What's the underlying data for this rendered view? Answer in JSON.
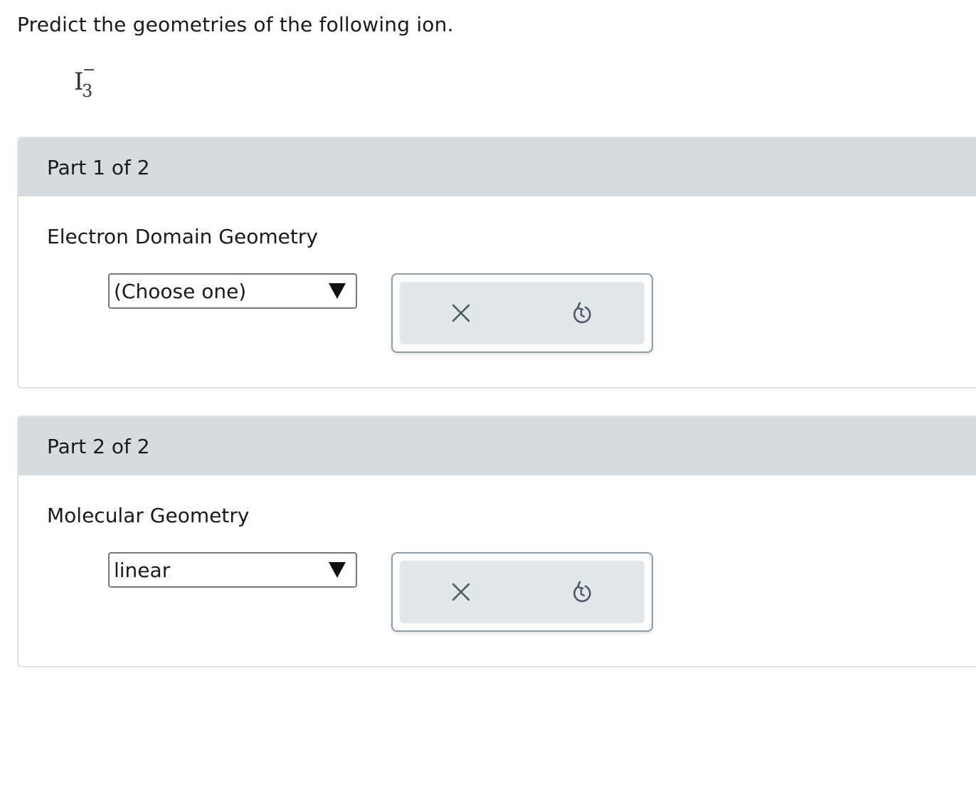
{
  "question": "Predict the geometries of the following ion.",
  "formula": {
    "symbol": "I",
    "subscript": "3",
    "charge": "−"
  },
  "parts": [
    {
      "header": "Part 1 of 2",
      "label": "Electron Domain Geometry",
      "select_value": "(Choose one)",
      "actions": {
        "clear_icon": "x-icon",
        "undo_icon": "undo-icon"
      }
    },
    {
      "header": "Part 2 of 2",
      "label": "Molecular Geometry",
      "select_value": "linear",
      "actions": {
        "clear_icon": "x-icon",
        "undo_icon": "undo-icon"
      }
    }
  ],
  "colors": {
    "header_bg": "#d5dce0",
    "action_bg": "#e2e8ea",
    "icon": "#4a5a65"
  }
}
